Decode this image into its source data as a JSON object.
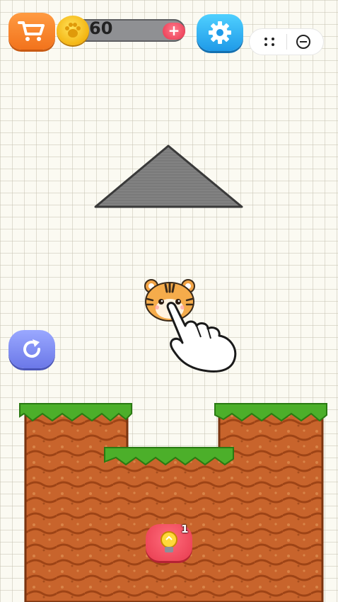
{
  "hud": {
    "coins": "60",
    "add_coin_symbol": "+",
    "hint_count": "1"
  },
  "icons": {
    "shop": "shopping-cart-icon",
    "coin": "paw-coin-icon",
    "settings": "gear-icon",
    "more": "dots-icon",
    "close": "circle-minus-icon",
    "restart": "restart-icon",
    "hint": "lightbulb-icon"
  },
  "colors": {
    "shop_button": "#f2731c",
    "settings_button": "#1f9ae8",
    "restart_button": "#6b78e8",
    "hint_button": "#e83a4e",
    "grass": "#4caf2a",
    "dirt": "#c8642c",
    "triangle": "#7a7a7a"
  }
}
